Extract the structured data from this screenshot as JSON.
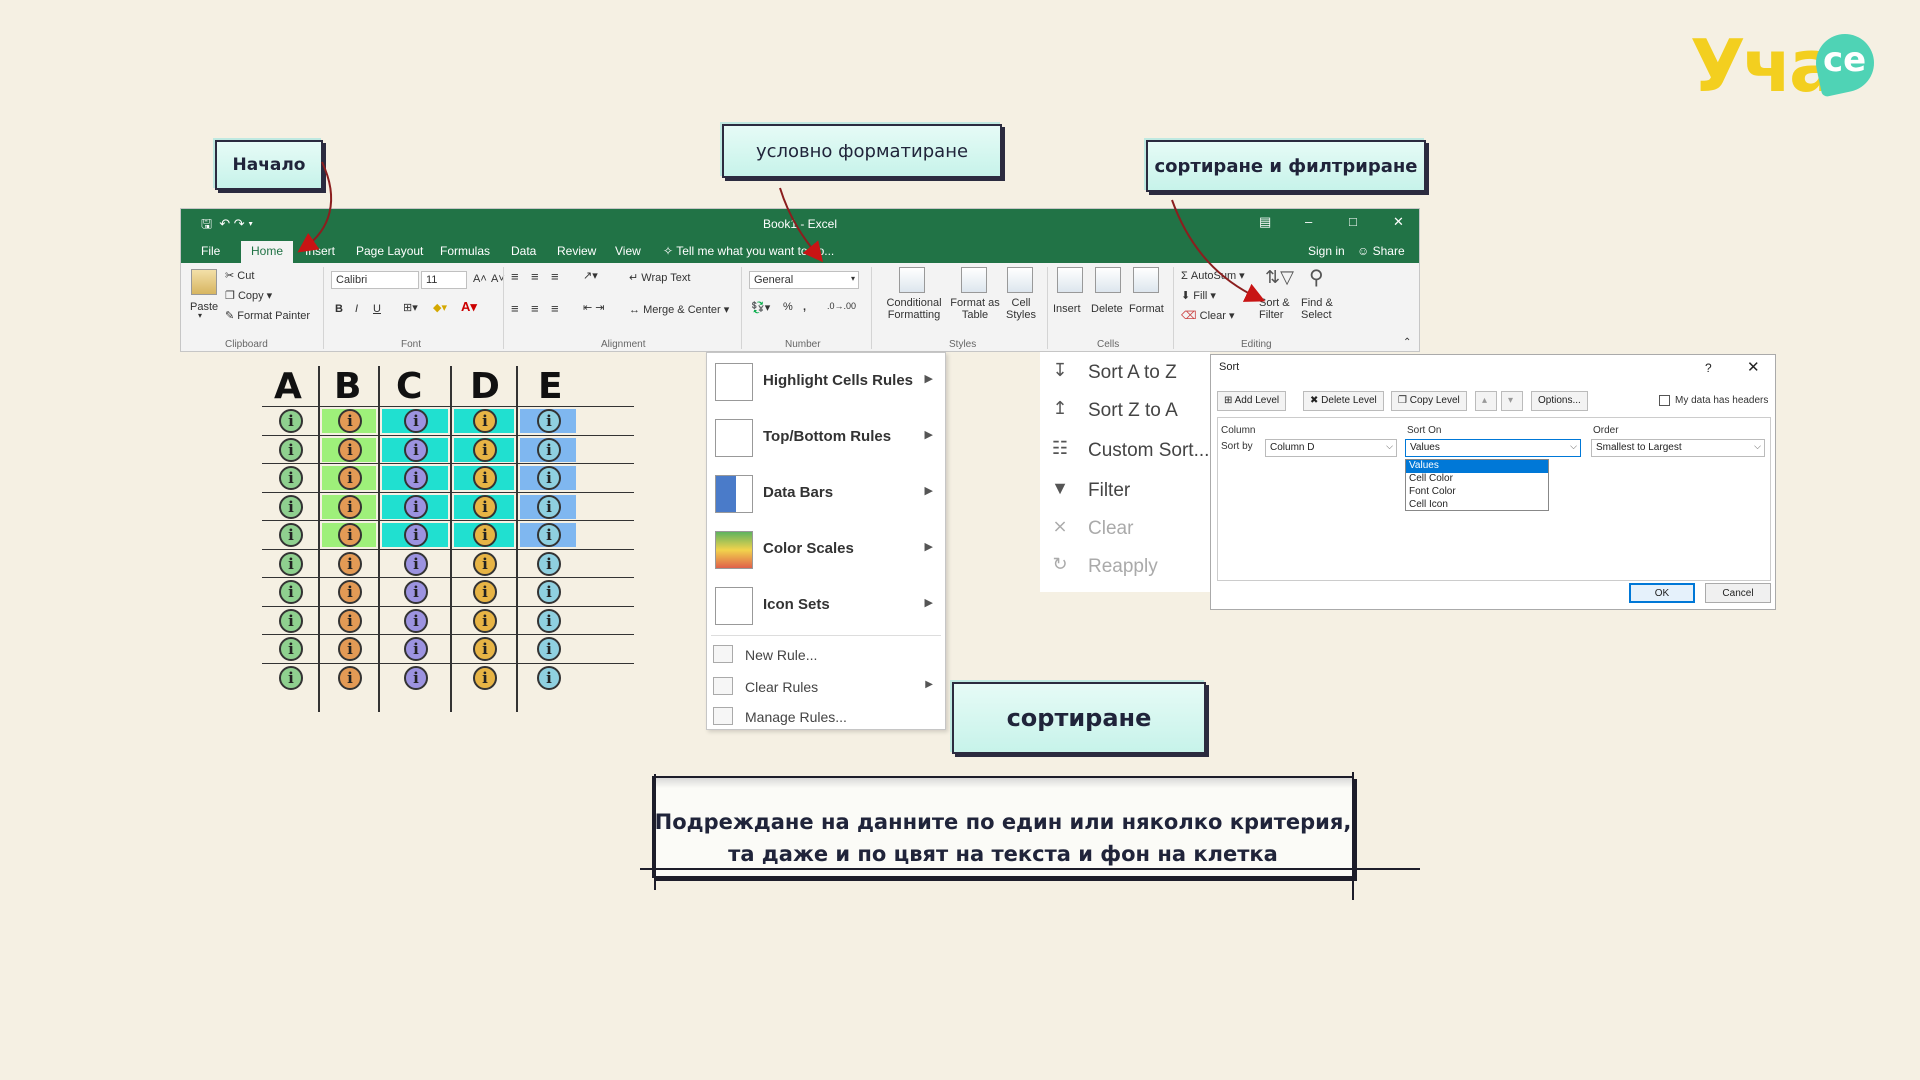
{
  "brand": {
    "logo_text": "Учасе",
    "logo_word": "Уча",
    "logo_suffix": "се"
  },
  "callouts": {
    "home": "Начало",
    "conditional": "условно форматиране",
    "sort_filter": "сортиране и филтриране",
    "sort": "сортиране"
  },
  "excel": {
    "title": "Book1 - Excel",
    "tabs": [
      "File",
      "Home",
      "Insert",
      "Page Layout",
      "Formulas",
      "Data",
      "Review",
      "View"
    ],
    "tell_me": "Tell me what you want to do...",
    "sign_in": "Sign in",
    "share": "Share",
    "clipboard": {
      "paste": "Paste",
      "cut": "Cut",
      "copy": "Copy",
      "format_painter": "Format Painter",
      "group": "Clipboard"
    },
    "font": {
      "name": "Calibri",
      "size": "11",
      "bold": "B",
      "italic": "I",
      "underline": "U",
      "grow": "A˄",
      "shrink": "A˅",
      "group": "Font"
    },
    "alignment": {
      "wrap_text": "Wrap Text",
      "merge_center": "Merge & Center",
      "group": "Alignment"
    },
    "number": {
      "format": "General",
      "percent": "%",
      "comma": ",",
      "group": "Number"
    },
    "styles": {
      "conditional": "Conditional",
      "conditional2": "Formatting",
      "format_as": "Format as",
      "format_as2": "Table",
      "cell": "Cell",
      "cell2": "Styles",
      "group": "Styles"
    },
    "cells": {
      "insert": "Insert",
      "delete": "Delete",
      "format": "Format",
      "group": "Cells"
    },
    "editing": {
      "autosum": "AutoSum",
      "fill": "Fill",
      "clear": "Clear",
      "sort": "Sort &",
      "sort2": "Filter",
      "find": "Find &",
      "find2": "Select",
      "group": "Editing"
    }
  },
  "grid": {
    "columns": [
      "A",
      "B",
      "C",
      "D",
      "E"
    ],
    "info_glyph": "i",
    "rows": 10,
    "highlighted_rows": 5,
    "colors": {
      "A_icon": "#8fd08f",
      "B_icon": "#e39a55",
      "C_icon": "#9c93e0",
      "D_icon": "#e7b445",
      "E_icon": "#8fd0e0",
      "B_fill": "#9ef07a",
      "C_fill": "#20e0d0",
      "D_fill": "#20e0d0",
      "E_fill": "#7fb7f0"
    }
  },
  "cf_menu": {
    "items": [
      {
        "label": "Highlight Cells Rules",
        "icon": "highlight-cells-icon"
      },
      {
        "label": "Top/Bottom Rules",
        "icon": "top-bottom-icon"
      },
      {
        "label": "Data Bars",
        "icon": "data-bars-icon"
      },
      {
        "label": "Color Scales",
        "icon": "color-scales-icon"
      },
      {
        "label": "Icon Sets",
        "icon": "icon-sets-icon"
      }
    ],
    "small": [
      {
        "label": "New Rule...",
        "has_arrow": false
      },
      {
        "label": "Clear Rules",
        "has_arrow": true
      },
      {
        "label": "Manage Rules...",
        "has_arrow": false
      }
    ]
  },
  "sf_menu": {
    "items": [
      {
        "label": "Sort A to Z",
        "icon": "sort-az-icon",
        "disabled": false
      },
      {
        "label": "Sort Z to A",
        "icon": "sort-za-icon",
        "disabled": false
      },
      {
        "label": "Custom Sort...",
        "icon": "custom-sort-icon",
        "disabled": false
      },
      {
        "label": "Filter",
        "icon": "filter-icon",
        "disabled": false
      },
      {
        "label": "Clear",
        "icon": "clear-filter-icon",
        "disabled": true
      },
      {
        "label": "Reapply",
        "icon": "reapply-icon",
        "disabled": true
      }
    ]
  },
  "sort_dialog": {
    "title": "Sort",
    "help": "?",
    "add_level": "Add Level",
    "delete_level": "Delete Level",
    "copy_level": "Copy Level",
    "options": "Options...",
    "headers_checkbox": "My data has headers",
    "col_header": "Column",
    "sorton_header": "Sort On",
    "order_header": "Order",
    "sort_by": "Sort by",
    "column_value": "Column D",
    "sorton_value": "Values",
    "order_value": "Smallest to Largest",
    "dropdown_options": [
      "Values",
      "Cell Color",
      "Font Color",
      "Cell Icon"
    ],
    "ok": "OK",
    "cancel": "Cancel"
  },
  "banner": {
    "line1": "Подреждане на данните  по един или няколко критерия,",
    "line2": "та даже и по цвят на текста и фон на клетка"
  }
}
